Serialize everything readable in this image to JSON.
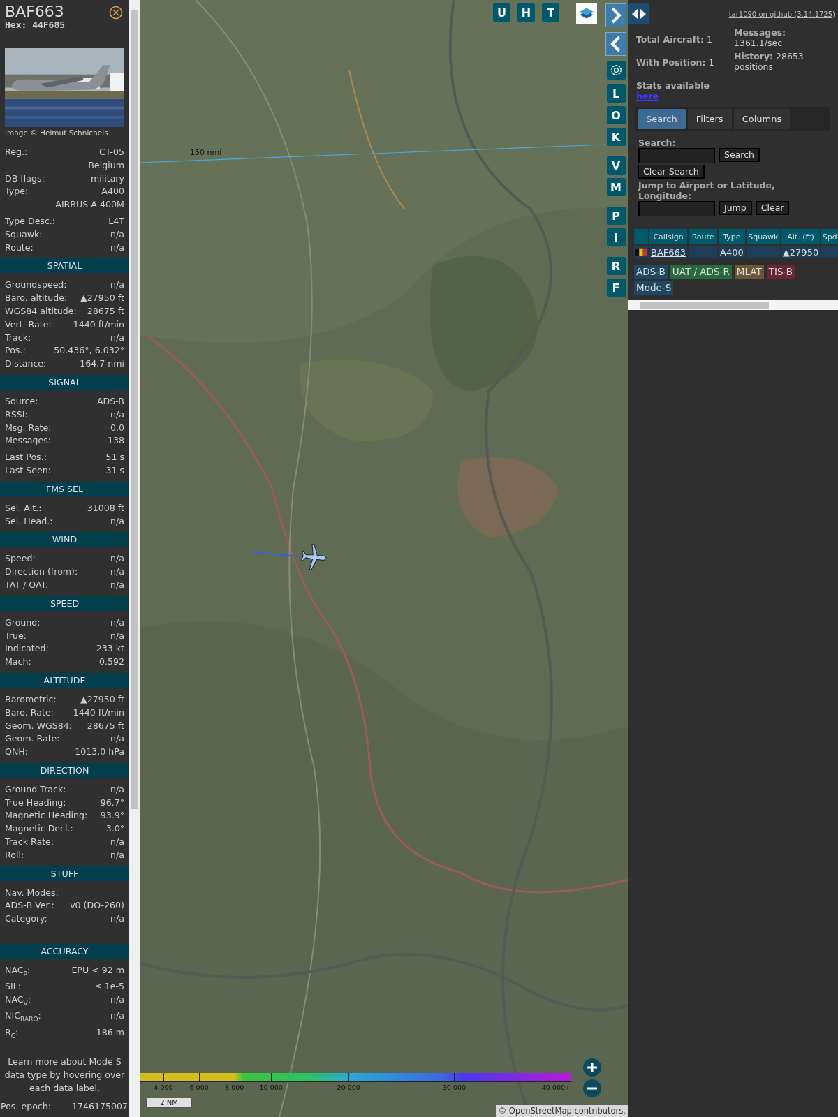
{
  "detail": {
    "callsign": "BAF663",
    "hex": "Hex: 44F685",
    "photo": {
      "kind": "picture"
    },
    "photo_credit": "Image © Helmut Schnichels",
    "rows": [
      {
        "kind": "link",
        "label": "Reg.:",
        "value": "CT-05"
      },
      {
        "kind": "text",
        "value": "Belgium"
      },
      {
        "kind": "text",
        "label": "DB flags:",
        "value": "military"
      },
      {
        "kind": "text",
        "label": "Type:",
        "value": "A400"
      },
      {
        "kind": "text",
        "value": "AIRBUS A-400M"
      },
      {
        "kind": "text",
        "label": "Type Desc.:",
        "value": "L4T"
      },
      {
        "kind": "text",
        "label": "Squawk:",
        "value": "n/a"
      },
      {
        "kind": "text",
        "label": "Route:",
        "value": "n/a"
      }
    ],
    "sections": [
      {
        "title": "SPATIAL",
        "rows": [
          {
            "label": "Groundspeed:",
            "value": "n/a"
          },
          {
            "label": "Baro. altitude:",
            "value": "▲27950 ft"
          },
          {
            "label": "WGS84 altitude:",
            "value": "28675 ft"
          },
          {
            "label": "Vert. Rate:",
            "value": "1440 ft/min"
          },
          {
            "label": "Track:",
            "value": "n/a"
          },
          {
            "label": "Pos.:",
            "value": "50.436°, 6.032°"
          },
          {
            "label": "Distance:",
            "value": "164.7 nmi"
          }
        ]
      },
      {
        "title": "SIGNAL",
        "rows": [
          {
            "label": "Source:",
            "value": "ADS-B"
          },
          {
            "label": "RSSI:",
            "value": "n/a"
          },
          {
            "label": "Msg. Rate:",
            "value": "0.0"
          },
          {
            "label": "Messages:",
            "value": "138"
          },
          {
            "label": "Last Pos.:",
            "value": "51 s"
          },
          {
            "label": "Last Seen:",
            "value": "31 s"
          }
        ]
      },
      {
        "title": "FMS SEL",
        "rows": [
          {
            "label": "Sel. Alt.:",
            "value": "31008 ft"
          },
          {
            "label": "Sel. Head.:",
            "value": "n/a"
          }
        ]
      },
      {
        "title": "WIND",
        "rows": [
          {
            "label": "Speed:",
            "value": "n/a"
          },
          {
            "label": "Direction (from):",
            "value": "n/a"
          },
          {
            "label": "TAT / OAT:",
            "value": "n/a"
          }
        ]
      },
      {
        "title": "SPEED",
        "rows": [
          {
            "label": "Ground:",
            "value": "n/a"
          },
          {
            "label": "True:",
            "value": "n/a"
          },
          {
            "label": "Indicated:",
            "value": "233 kt"
          },
          {
            "label": "Mach:",
            "value": "0.592"
          }
        ]
      },
      {
        "title": "ALTITUDE",
        "rows": [
          {
            "label": "Barometric:",
            "value": "▲27950 ft"
          },
          {
            "label": "Baro. Rate:",
            "value": "1440 ft/min"
          },
          {
            "label": "Geom. WGS84:",
            "value": "28675 ft"
          },
          {
            "label": "Geom. Rate:",
            "value": "n/a"
          },
          {
            "label": "QNH:",
            "value": "1013.0 hPa"
          }
        ]
      },
      {
        "title": "DIRECTION",
        "rows": [
          {
            "label": "Ground Track:",
            "value": "n/a"
          },
          {
            "label": "True Heading:",
            "value": "96.7°"
          },
          {
            "label": "Magnetic Heading:",
            "value": "93.9°"
          },
          {
            "label": "Magnetic Decl.:",
            "value": "3.0°"
          },
          {
            "label": "Track Rate:",
            "value": "n/a"
          },
          {
            "label": "Roll:",
            "value": "n/a"
          }
        ]
      },
      {
        "title": "STUFF",
        "rows": [
          {
            "label": "Nav. Modes:"
          },
          {
            "label": "ADS-B Ver.:",
            "value": "v0 (DO-260)"
          },
          {
            "label": "Category:",
            "value": "n/a"
          }
        ]
      },
      {
        "title": "ACCURACY",
        "rows": [
          {
            "label": "NAC$_{P}$:",
            "value": "EPU < 92 m"
          },
          {
            "label": "SIL:",
            "value": "≤ 1e-5"
          },
          {
            "label": "NAC$_{V}$:",
            "value": "n/a"
          },
          {
            "label": "NIC$_{BARO}$:",
            "value": "n/a"
          },
          {
            "label": "R$_{C}$:",
            "value": "186 m"
          }
        ]
      }
    ],
    "note": "Learn more about Mode S data type by hovering over each data label.",
    "last_row": {
      "label": "Pos. epoch:",
      "value": "1746175007"
    }
  },
  "map": {
    "picture": {
      "kind": "picture"
    },
    "range_label": "150 nmi",
    "top_buttons": [
      "U",
      "H",
      "T"
    ],
    "side_groups": [
      [
        "L",
        "O",
        "K"
      ],
      [
        "V",
        "M"
      ],
      [
        "P",
        "I"
      ],
      [
        "R",
        "F"
      ]
    ],
    "altitude_legend": [
      "4 000",
      "6 000",
      "8 000",
      "10 000",
      "20 000",
      "30 000",
      "40 000+"
    ],
    "scale": "2 NM",
    "attribution": "© OpenStreetMap contributors."
  },
  "panel": {
    "github_link": "tar1090 on github (3.14.1725)",
    "stats_left": [
      "**Total Aircraft:** 1",
      "**With Position:** 1"
    ],
    "stats_available": "Stats available",
    "stats_link": "here",
    "stats_right": [
      "**Messages:** 1361.1/sec",
      "**History:** 28653 positions"
    ],
    "tabs": [
      {
        "label": "Search",
        "selected": true
      },
      {
        "label": "Filters",
        "selected": false
      },
      {
        "label": "Columns",
        "selected": false
      }
    ],
    "search": {
      "label": "Search:",
      "button": "Search",
      "clear_button": "Clear Search",
      "jump_label": "Jump to Airport or Latitude, Longitude:",
      "jump_button": "Jump",
      "jump_clear_button": "Clear"
    },
    "table": {
      "columns": [
        "Callsign",
        "Route",
        "Type",
        "Squawk",
        "Alt. (ft)",
        "Spd"
      ],
      "rows": [
        {
          "cells": [
            {
              "kind": "link",
              "text": "BAF663"
            },
            {
              "kind": "empty"
            },
            {
              "kind": "text",
              "text": "A400"
            },
            {
              "kind": "empty"
            },
            {
              "kind": "text",
              "text": "▲27950"
            },
            {
              "kind": "empty"
            }
          ]
        }
      ]
    },
    "source_legend": [
      {
        "label": "ADS-B",
        "color": "#1f4862"
      },
      {
        "label": "UAT / ADS-R",
        "color": "#286a3c"
      },
      {
        "label": "MLAT",
        "color": "#6a5638"
      },
      {
        "label": "TIS-B",
        "color": "#6b2634"
      },
      {
        "label": "Mode-S",
        "color": "#1f4862"
      }
    ]
  }
}
